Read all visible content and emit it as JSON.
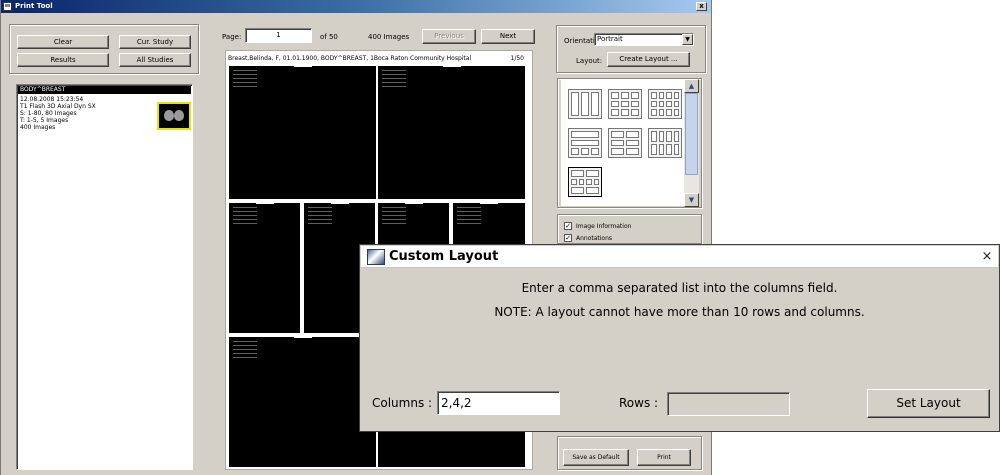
{
  "window": {
    "title": "Print Tool",
    "close_glyph": "x"
  },
  "left_panel": {
    "buttons": {
      "clear": "Clear",
      "cur_study": "Cur. Study",
      "results": "Results",
      "all_studies": "All Studies"
    },
    "study": {
      "header": "BODY^BREAST",
      "lines": [
        "12.08.2008 15:23:54",
        "T1 Flash 3D Axial Dyn SX",
        "S: 1-80, 80 Images",
        "T: 1-5, 5 Images",
        "400 Images"
      ]
    }
  },
  "pager": {
    "page_label": "Page:",
    "page_value": "1",
    "of_text": "of 50",
    "image_count": "400 Images",
    "previous_label": "Previous",
    "next_label": "Next"
  },
  "sheet": {
    "header": "Breast,Belinda, F, 01.01.1900, BODY^BREAST, 1Boca Raton Community Hospital",
    "page_indicator": "1/50"
  },
  "right_panel": {
    "orientation_label": "Orientation:",
    "orientation_value": "Portrait",
    "layout_label": "Layout:",
    "create_layout_label": "Create Layout ...",
    "option_image_info": "Image Information",
    "option_annotations": "Annotations",
    "save_default_label": "Save as Default",
    "print_label": "Print"
  },
  "dialog": {
    "title": "Custom Layout",
    "close_glyph": "×",
    "line1": "Enter a comma separated list into the columns field.",
    "line2": "NOTE: A layout cannot have more than 10 rows and columns.",
    "columns_label": "Columns :",
    "columns_value": "2,4,2",
    "rows_label": "Rows :",
    "rows_value": "",
    "set_layout_label": "Set Layout"
  },
  "icons": {
    "app": "print-tool-icon",
    "dialog": "custom-layout-icon",
    "orientation_dropdown": "chevron-down-icon",
    "scroll_up": "arrow-up-icon",
    "scroll_down": "arrow-down-icon"
  },
  "colors": {
    "titlebar": "#0a246a",
    "window_bg": "#d4d0c8",
    "thumb_highlight": "#e6e600"
  }
}
